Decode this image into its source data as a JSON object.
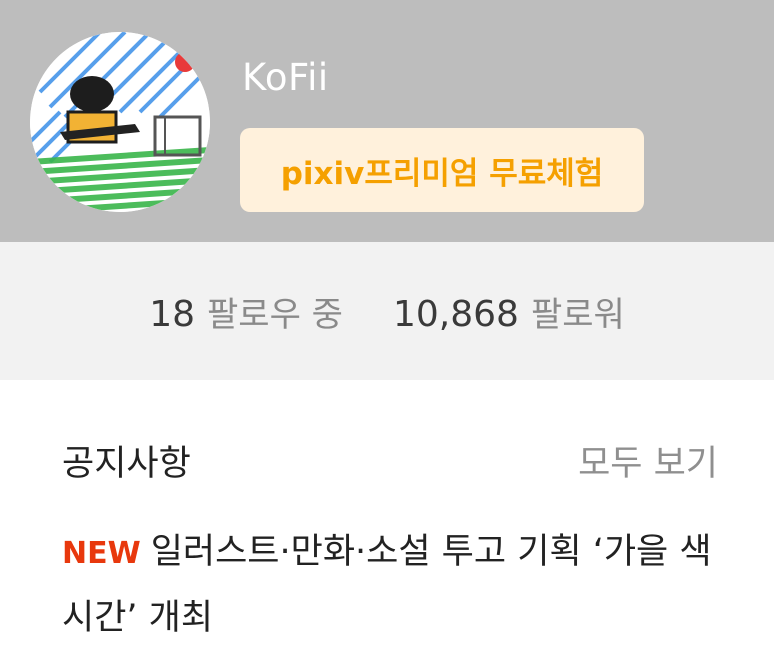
{
  "profile": {
    "username": "KoFii",
    "premium_label": "pixiv프리미엄 무료체험"
  },
  "stats": {
    "following_count": "18",
    "following_label": "팔로우 중",
    "followers_count": "10,868",
    "followers_label": "팔로워"
  },
  "notices": {
    "title": "공지사항",
    "view_all_label": "모두 보기",
    "items": [
      {
        "badge": "NEW",
        "text": "일러스트·만화·소설 투고 기획 ‘가을 색 시간’ 개최"
      }
    ]
  },
  "colors": {
    "header_bg": "#bdbdbd",
    "premium_bg": "#fff1dc",
    "premium_text": "#f5a000",
    "new_badge": "#e8380d",
    "stats_bg": "#f2f2f2"
  }
}
